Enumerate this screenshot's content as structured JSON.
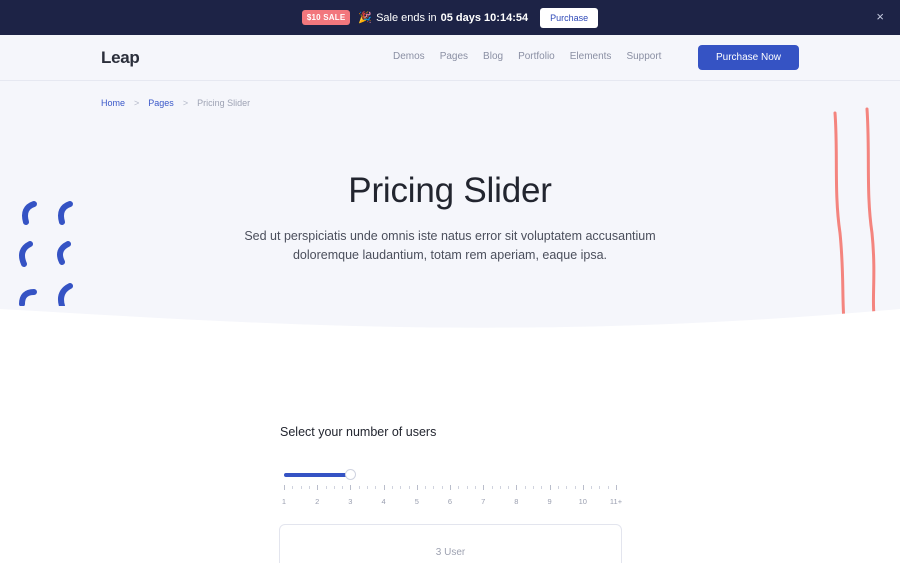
{
  "promo": {
    "badge": "$10 SALE",
    "icon": "party-popper-icon",
    "text_prefix": "Sale ends in",
    "countdown": "05 days 10:14:54",
    "button": "Purchase",
    "close": "×"
  },
  "nav": {
    "logo": "Leap",
    "links": [
      "Demos",
      "Pages",
      "Blog",
      "Portfolio",
      "Elements",
      "Support"
    ],
    "cta": "Purchase Now"
  },
  "breadcrumb": {
    "items": [
      "Home",
      "Pages",
      "Pricing Slider"
    ],
    "separator": ">"
  },
  "hero": {
    "title": "Pricing Slider",
    "subtitle": "Sed ut perspiciatis unde omnis iste natus error sit voluptatem accusantium doloremque laudantium, totam rem aperiam, eaque ipsa."
  },
  "pricing": {
    "title": "Select your number of users",
    "slider": {
      "min": 1,
      "max": 11,
      "value": 3
    },
    "tick_labels": [
      "1",
      "2",
      "3",
      "4",
      "5",
      "6",
      "7",
      "8",
      "9",
      "10",
      "11+"
    ],
    "card_users": "3 User"
  },
  "colors": {
    "promo_bg": "#1d2346",
    "accent": "#3553c4",
    "sale_badge": "#f2777d",
    "hero_bg": "#f5f6fb",
    "deco_blue": "#3553c4",
    "deco_coral": "#f4847e"
  }
}
